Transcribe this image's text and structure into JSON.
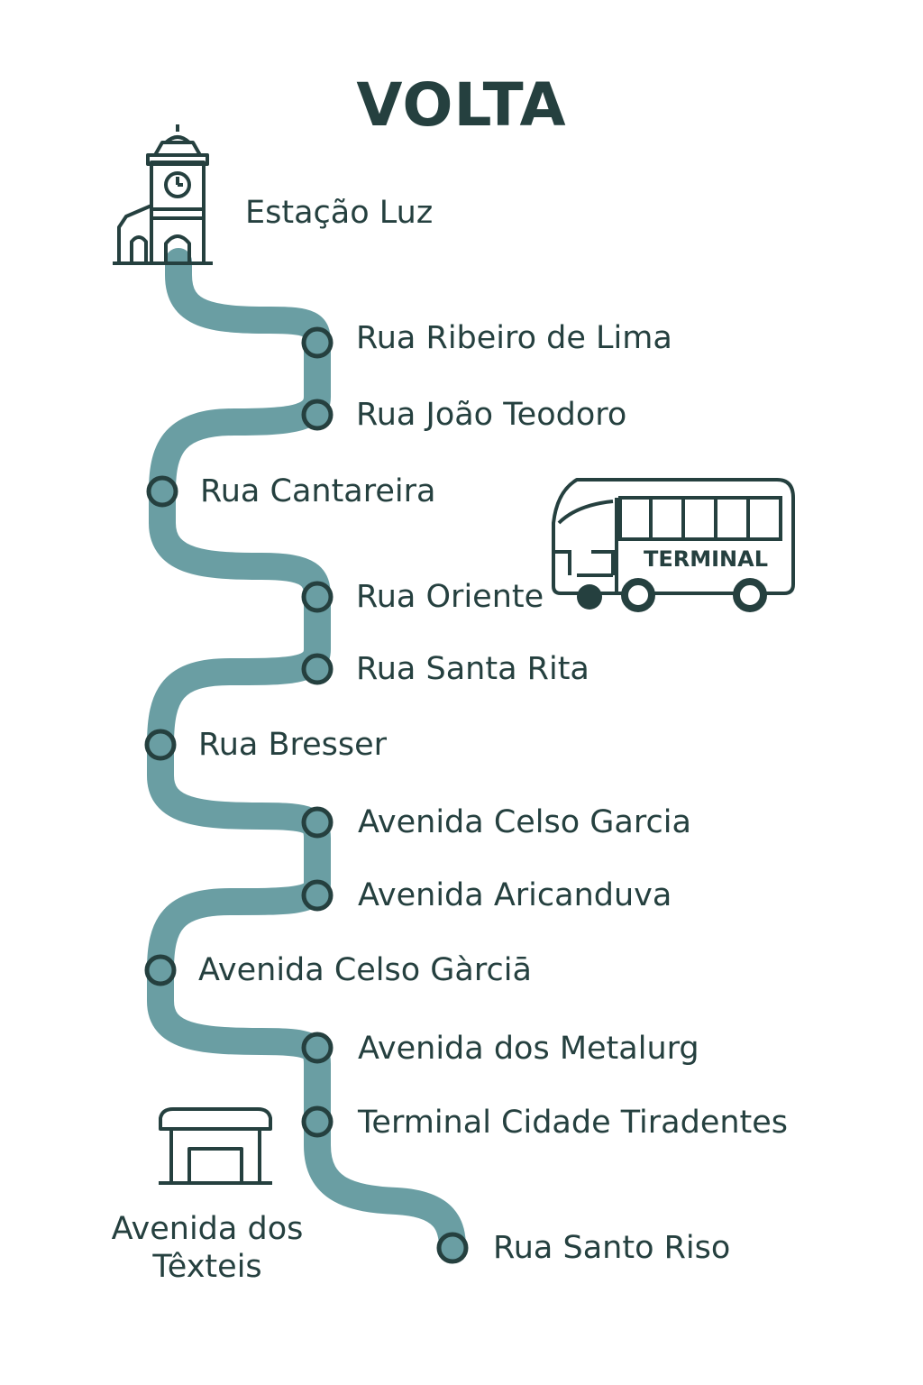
{
  "title": "VOLTA",
  "colors": {
    "route_line": "#6a9ea3",
    "stop_fill": "#6a9ea3",
    "stop_stroke": "#25403f",
    "ink": "#25403f"
  },
  "start_landmark": {
    "icon": "church-clock-tower-icon",
    "label": "Estação Luz"
  },
  "stops": [
    {
      "label": "Rua Ribeiro de Lima"
    },
    {
      "label": "Rua João Teodoro"
    },
    {
      "label": "Rua Cantareira"
    },
    {
      "label": "Rua Oriente"
    },
    {
      "label": "Rua Santa Rita"
    },
    {
      "label": "Rua Bresser"
    },
    {
      "label": "Avenida Celso Garcia"
    },
    {
      "label": "Avenida Aricanduva"
    },
    {
      "label": "Avenida Celso Gàrciā"
    },
    {
      "label": "Avenida dos Metalurg"
    },
    {
      "label": "Terminal Cidade Tiradentes"
    },
    {
      "label": "Rua Santo Riso"
    }
  ],
  "bus": {
    "icon": "bus-icon",
    "label": "TERMINAL"
  },
  "depot": {
    "icon": "bus-shelter-icon",
    "label_line1": "Avenida dos",
    "label_line2": "Têxteis"
  }
}
